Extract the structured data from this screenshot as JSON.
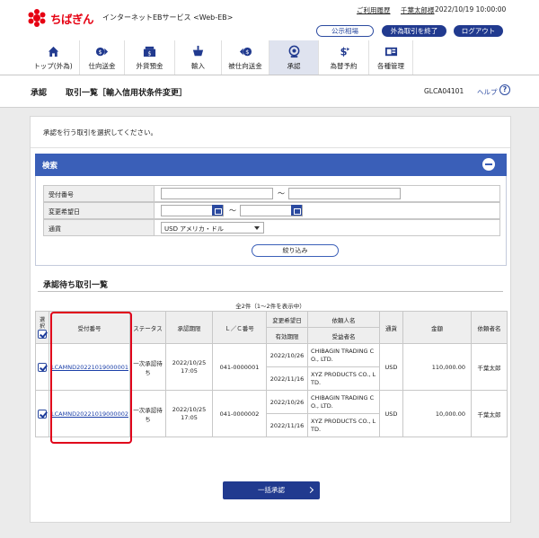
{
  "header": {
    "brand": "ちばぎん",
    "service": "インターネットEBサービス <Web-EB>",
    "usage_history": "ご利用履歴",
    "user": "千葉太郎様",
    "datetime": "2022/10/19 10:00:00",
    "fx_rates": "公示相場",
    "end_fx": "外為取引を終了",
    "logout": "ログアウト"
  },
  "nav": [
    {
      "label": "トップ(外為)",
      "icon": "home-icon"
    },
    {
      "label": "仕向送金",
      "icon": "outward-remittance-icon"
    },
    {
      "label": "外貨預金",
      "icon": "fx-deposit-icon"
    },
    {
      "label": "輸入",
      "icon": "import-icon"
    },
    {
      "label": "被仕向送金",
      "icon": "inward-remittance-icon"
    },
    {
      "label": "承認",
      "icon": "approval-icon"
    },
    {
      "label": "為替予約",
      "icon": "fx-contract-icon"
    },
    {
      "label": "各種管理",
      "icon": "management-icon"
    }
  ],
  "title": {
    "main": "承認",
    "sub": "取引一覧［輸入信用状条件変更］",
    "screen_id": "GLCA04101",
    "help": "ヘルプ",
    "help_icon": "?"
  },
  "instruction": "承認を行う取引を選択してください。",
  "search": {
    "title": "検索",
    "receipt_label": "受付番号",
    "change_date_label": "変更希望日",
    "currency_label": "通貨",
    "currency_value": "USD  アメリカ・ドル",
    "tilde": "～",
    "filter_button": "絞り込み"
  },
  "list": {
    "title": "承認待ち取引一覧",
    "count": "全2件（1～2件を表示中）",
    "headers": {
      "select": "選択",
      "receipt": "受付番号",
      "status": "ステータス",
      "deadline": "承認期限",
      "lc_no": "Ｌ／Ｃ番号",
      "change_date": "変更希望日",
      "expiry": "有効期限",
      "applicant": "依頼人名",
      "beneficiary": "受益者名",
      "currency": "通貨",
      "amount": "金額",
      "requester": "依頼者名"
    },
    "rows": [
      {
        "receipt": "LCAMND20221019000001",
        "status": "一次承認待ち",
        "deadline": "2022/10/25 17:05",
        "lc_no": "041-0000001",
        "change_date": "2022/10/26",
        "expiry": "2022/11/16",
        "applicant": "CHIBAGIN TRADING CO., LTD.",
        "beneficiary": "XYZ PRODUCTS CO., LTD.",
        "currency": "USD",
        "amount": "110,000.00",
        "requester": "千葉太郎"
      },
      {
        "receipt": "LCAMND20221019000002",
        "status": "一次承認待ち",
        "deadline": "2022/10/25 17:05",
        "lc_no": "041-0000002",
        "change_date": "2022/10/26",
        "expiry": "2022/11/16",
        "applicant": "CHIBAGIN TRADING CO., LTD.",
        "beneficiary": "XYZ PRODUCTS CO., LTD.",
        "currency": "USD",
        "amount": "10,000.00",
        "requester": "千葉太郎"
      }
    ]
  },
  "approve_button": "一括承認",
  "colors": {
    "brand_red": "#e60012",
    "primary_blue": "#213a8f",
    "header_blue": "#3a5fb8",
    "highlight_red": "#e0001a"
  }
}
